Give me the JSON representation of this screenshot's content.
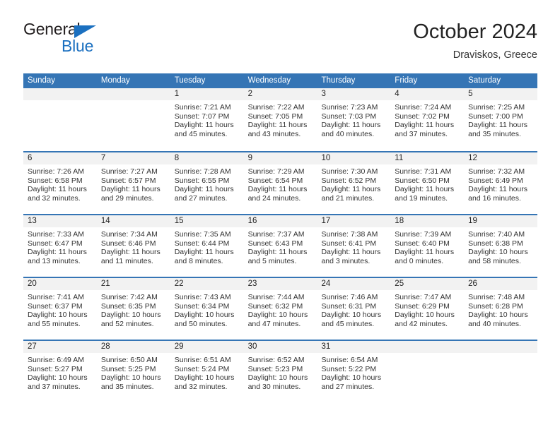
{
  "logo": {
    "word_top": "General",
    "word_bottom": "Blue",
    "triangle_color": "#1b70c0",
    "icon": "general-blue-logo"
  },
  "header": {
    "title": "October 2024",
    "subtitle": "Draviskos, Greece"
  },
  "colors": {
    "header_blue": "#3575b5",
    "daynum_gray": "#f2f2f2",
    "text": "#333333"
  },
  "weekdays": [
    "Sunday",
    "Monday",
    "Tuesday",
    "Wednesday",
    "Thursday",
    "Friday",
    "Saturday"
  ],
  "weeks": [
    [
      {
        "day": "",
        "empty": true,
        "sunrise": "",
        "sunset": "",
        "daylight_line1": "",
        "daylight_line2": ""
      },
      {
        "day": "",
        "empty": true,
        "sunrise": "",
        "sunset": "",
        "daylight_line1": "",
        "daylight_line2": ""
      },
      {
        "day": "1",
        "sunrise": "Sunrise: 7:21 AM",
        "sunset": "Sunset: 7:07 PM",
        "daylight_line1": "Daylight: 11 hours",
        "daylight_line2": "and 45 minutes."
      },
      {
        "day": "2",
        "sunrise": "Sunrise: 7:22 AM",
        "sunset": "Sunset: 7:05 PM",
        "daylight_line1": "Daylight: 11 hours",
        "daylight_line2": "and 43 minutes."
      },
      {
        "day": "3",
        "sunrise": "Sunrise: 7:23 AM",
        "sunset": "Sunset: 7:03 PM",
        "daylight_line1": "Daylight: 11 hours",
        "daylight_line2": "and 40 minutes."
      },
      {
        "day": "4",
        "sunrise": "Sunrise: 7:24 AM",
        "sunset": "Sunset: 7:02 PM",
        "daylight_line1": "Daylight: 11 hours",
        "daylight_line2": "and 37 minutes."
      },
      {
        "day": "5",
        "sunrise": "Sunrise: 7:25 AM",
        "sunset": "Sunset: 7:00 PM",
        "daylight_line1": "Daylight: 11 hours",
        "daylight_line2": "and 35 minutes."
      }
    ],
    [
      {
        "day": "6",
        "sunrise": "Sunrise: 7:26 AM",
        "sunset": "Sunset: 6:58 PM",
        "daylight_line1": "Daylight: 11 hours",
        "daylight_line2": "and 32 minutes."
      },
      {
        "day": "7",
        "sunrise": "Sunrise: 7:27 AM",
        "sunset": "Sunset: 6:57 PM",
        "daylight_line1": "Daylight: 11 hours",
        "daylight_line2": "and 29 minutes."
      },
      {
        "day": "8",
        "sunrise": "Sunrise: 7:28 AM",
        "sunset": "Sunset: 6:55 PM",
        "daylight_line1": "Daylight: 11 hours",
        "daylight_line2": "and 27 minutes."
      },
      {
        "day": "9",
        "sunrise": "Sunrise: 7:29 AM",
        "sunset": "Sunset: 6:54 PM",
        "daylight_line1": "Daylight: 11 hours",
        "daylight_line2": "and 24 minutes."
      },
      {
        "day": "10",
        "sunrise": "Sunrise: 7:30 AM",
        "sunset": "Sunset: 6:52 PM",
        "daylight_line1": "Daylight: 11 hours",
        "daylight_line2": "and 21 minutes."
      },
      {
        "day": "11",
        "sunrise": "Sunrise: 7:31 AM",
        "sunset": "Sunset: 6:50 PM",
        "daylight_line1": "Daylight: 11 hours",
        "daylight_line2": "and 19 minutes."
      },
      {
        "day": "12",
        "sunrise": "Sunrise: 7:32 AM",
        "sunset": "Sunset: 6:49 PM",
        "daylight_line1": "Daylight: 11 hours",
        "daylight_line2": "and 16 minutes."
      }
    ],
    [
      {
        "day": "13",
        "sunrise": "Sunrise: 7:33 AM",
        "sunset": "Sunset: 6:47 PM",
        "daylight_line1": "Daylight: 11 hours",
        "daylight_line2": "and 13 minutes."
      },
      {
        "day": "14",
        "sunrise": "Sunrise: 7:34 AM",
        "sunset": "Sunset: 6:46 PM",
        "daylight_line1": "Daylight: 11 hours",
        "daylight_line2": "and 11 minutes."
      },
      {
        "day": "15",
        "sunrise": "Sunrise: 7:35 AM",
        "sunset": "Sunset: 6:44 PM",
        "daylight_line1": "Daylight: 11 hours",
        "daylight_line2": "and 8 minutes."
      },
      {
        "day": "16",
        "sunrise": "Sunrise: 7:37 AM",
        "sunset": "Sunset: 6:43 PM",
        "daylight_line1": "Daylight: 11 hours",
        "daylight_line2": "and 5 minutes."
      },
      {
        "day": "17",
        "sunrise": "Sunrise: 7:38 AM",
        "sunset": "Sunset: 6:41 PM",
        "daylight_line1": "Daylight: 11 hours",
        "daylight_line2": "and 3 minutes."
      },
      {
        "day": "18",
        "sunrise": "Sunrise: 7:39 AM",
        "sunset": "Sunset: 6:40 PM",
        "daylight_line1": "Daylight: 11 hours",
        "daylight_line2": "and 0 minutes."
      },
      {
        "day": "19",
        "sunrise": "Sunrise: 7:40 AM",
        "sunset": "Sunset: 6:38 PM",
        "daylight_line1": "Daylight: 10 hours",
        "daylight_line2": "and 58 minutes."
      }
    ],
    [
      {
        "day": "20",
        "sunrise": "Sunrise: 7:41 AM",
        "sunset": "Sunset: 6:37 PM",
        "daylight_line1": "Daylight: 10 hours",
        "daylight_line2": "and 55 minutes."
      },
      {
        "day": "21",
        "sunrise": "Sunrise: 7:42 AM",
        "sunset": "Sunset: 6:35 PM",
        "daylight_line1": "Daylight: 10 hours",
        "daylight_line2": "and 52 minutes."
      },
      {
        "day": "22",
        "sunrise": "Sunrise: 7:43 AM",
        "sunset": "Sunset: 6:34 PM",
        "daylight_line1": "Daylight: 10 hours",
        "daylight_line2": "and 50 minutes."
      },
      {
        "day": "23",
        "sunrise": "Sunrise: 7:44 AM",
        "sunset": "Sunset: 6:32 PM",
        "daylight_line1": "Daylight: 10 hours",
        "daylight_line2": "and 47 minutes."
      },
      {
        "day": "24",
        "sunrise": "Sunrise: 7:46 AM",
        "sunset": "Sunset: 6:31 PM",
        "daylight_line1": "Daylight: 10 hours",
        "daylight_line2": "and 45 minutes."
      },
      {
        "day": "25",
        "sunrise": "Sunrise: 7:47 AM",
        "sunset": "Sunset: 6:29 PM",
        "daylight_line1": "Daylight: 10 hours",
        "daylight_line2": "and 42 minutes."
      },
      {
        "day": "26",
        "sunrise": "Sunrise: 7:48 AM",
        "sunset": "Sunset: 6:28 PM",
        "daylight_line1": "Daylight: 10 hours",
        "daylight_line2": "and 40 minutes."
      }
    ],
    [
      {
        "day": "27",
        "sunrise": "Sunrise: 6:49 AM",
        "sunset": "Sunset: 5:27 PM",
        "daylight_line1": "Daylight: 10 hours",
        "daylight_line2": "and 37 minutes."
      },
      {
        "day": "28",
        "sunrise": "Sunrise: 6:50 AM",
        "sunset": "Sunset: 5:25 PM",
        "daylight_line1": "Daylight: 10 hours",
        "daylight_line2": "and 35 minutes."
      },
      {
        "day": "29",
        "sunrise": "Sunrise: 6:51 AM",
        "sunset": "Sunset: 5:24 PM",
        "daylight_line1": "Daylight: 10 hours",
        "daylight_line2": "and 32 minutes."
      },
      {
        "day": "30",
        "sunrise": "Sunrise: 6:52 AM",
        "sunset": "Sunset: 5:23 PM",
        "daylight_line1": "Daylight: 10 hours",
        "daylight_line2": "and 30 minutes."
      },
      {
        "day": "31",
        "sunrise": "Sunrise: 6:54 AM",
        "sunset": "Sunset: 5:22 PM",
        "daylight_line1": "Daylight: 10 hours",
        "daylight_line2": "and 27 minutes."
      },
      {
        "day": "",
        "empty": true,
        "sunrise": "",
        "sunset": "",
        "daylight_line1": "",
        "daylight_line2": ""
      },
      {
        "day": "",
        "empty": true,
        "sunrise": "",
        "sunset": "",
        "daylight_line1": "",
        "daylight_line2": ""
      }
    ]
  ]
}
